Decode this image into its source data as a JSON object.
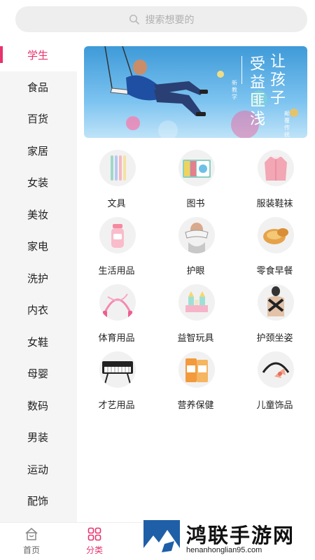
{
  "search": {
    "placeholder": "搜索想要的"
  },
  "sidebar": {
    "items": [
      {
        "label": "学生",
        "active": true
      },
      {
        "label": "食品"
      },
      {
        "label": "百货"
      },
      {
        "label": "家居"
      },
      {
        "label": "女装"
      },
      {
        "label": "美妆"
      },
      {
        "label": "家电"
      },
      {
        "label": "洗护"
      },
      {
        "label": "内衣"
      },
      {
        "label": "女鞋"
      },
      {
        "label": "母婴"
      },
      {
        "label": "数码"
      },
      {
        "label": "男装"
      },
      {
        "label": "运动"
      },
      {
        "label": "配饰"
      }
    ]
  },
  "banner": {
    "headline_a": "让孩子",
    "headline_b": "受益匪浅",
    "small_a": "新教学",
    "small_b": "颠覆传统"
  },
  "categories": [
    {
      "label": "文具",
      "icon": "pens-icon"
    },
    {
      "label": "图书",
      "icon": "books-icon"
    },
    {
      "label": "服装鞋袜",
      "icon": "coat-icon"
    },
    {
      "label": "生活用品",
      "icon": "bottle-icon"
    },
    {
      "label": "护眼",
      "icon": "eye-massager-icon"
    },
    {
      "label": "零食早餐",
      "icon": "pastry-icon"
    },
    {
      "label": "体育用品",
      "icon": "jump-rope-icon"
    },
    {
      "label": "益智玩具",
      "icon": "toy-blocks-icon"
    },
    {
      "label": "护颈坐姿",
      "icon": "posture-brace-icon"
    },
    {
      "label": "才艺用品",
      "icon": "keyboard-icon"
    },
    {
      "label": "营养保健",
      "icon": "supplement-icon"
    },
    {
      "label": "儿童饰品",
      "icon": "headband-icon"
    }
  ],
  "tabbar": {
    "home_label": "首页",
    "category_label": "分类"
  },
  "watermark": {
    "title": "鸿联手游网",
    "url": "henanhonglian95.com"
  },
  "colors": {
    "accent": "#e8336d",
    "sidebar_bg": "#f5f5f5"
  }
}
